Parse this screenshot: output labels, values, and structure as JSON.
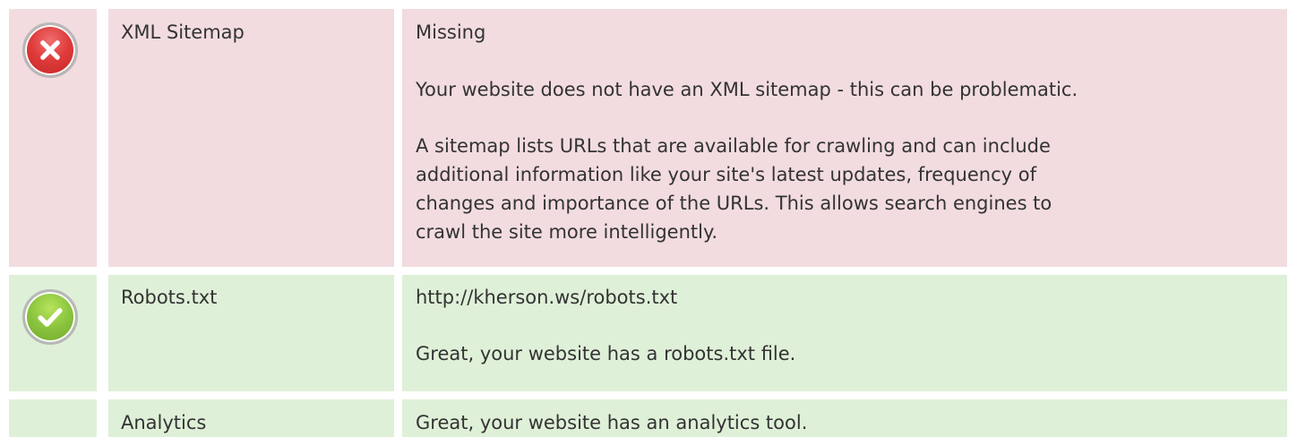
{
  "rows": [
    {
      "status": "error",
      "icon": "error-x-icon",
      "name": "XML Sitemap",
      "lines": [
        "Missing",
        "Your website does not have an XML sitemap - this can be problematic.",
        "A sitemap lists URLs that are available for crawling and can include",
        "additional information like your site's latest updates, frequency of",
        "changes and importance of the URLs. This allows search engines to",
        "crawl the site more intelligently."
      ]
    },
    {
      "status": "ok",
      "icon": "success-check-icon",
      "name": "Robots.txt",
      "lines": [
        "http://kherson.ws/robots.txt",
        "Great, your website has a robots.txt file."
      ]
    },
    {
      "status": "ok",
      "icon": "success-check-icon",
      "name": "Analytics",
      "lines": [
        "Great, your website has an analytics tool."
      ]
    }
  ],
  "colors": {
    "error_bg": "#f2dcdf",
    "ok_bg": "#dff0d8",
    "text": "#333333",
    "error_icon": "#df3b3b",
    "ok_icon": "#8cc63f"
  }
}
